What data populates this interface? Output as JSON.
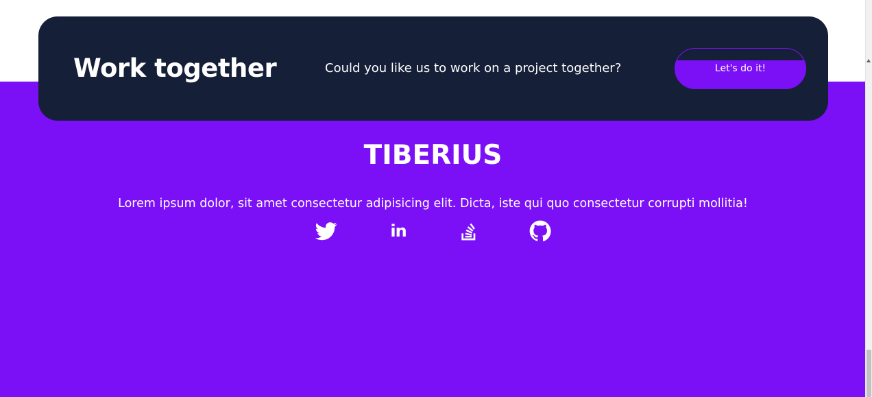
{
  "cta": {
    "title": "Work together",
    "question": "Could you like us to work on a project together?",
    "button_label": "Let's do it!"
  },
  "footer": {
    "brand": "TIBERIUS",
    "description": "Lorem ipsum dolor, sit amet consectetur adipisicing elit. Dicta, iste qui quo consectetur corrupti mollitia!",
    "social_links": [
      {
        "icon": "twitter-icon",
        "text": ""
      },
      {
        "icon": "linkedin-icon",
        "text": "in"
      },
      {
        "icon": "stack-overflow-icon",
        "text": ""
      },
      {
        "icon": "github-icon",
        "text": ""
      }
    ]
  },
  "colors": {
    "brand_purple": "#7b10f7",
    "card_navy": "#161f38",
    "text_white": "#ffffff"
  }
}
